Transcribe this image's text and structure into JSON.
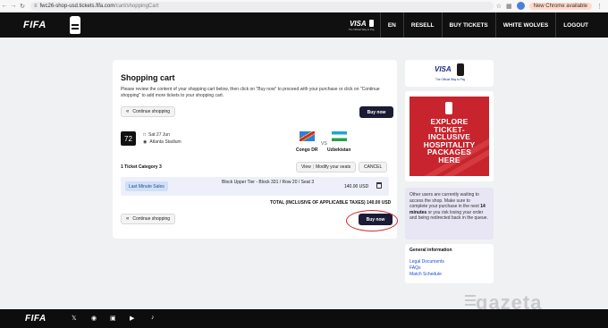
{
  "browser": {
    "url_host": "fwc26-shop-usd.tickets.fifa.com",
    "url_path": "/cart/shoppingCart",
    "update_label": "New Chrome available"
  },
  "header": {
    "logo": "FIFA",
    "visa_logo": "VISA",
    "visa_tagline": "The Official Way to Pay",
    "nav": [
      "EN",
      "RESELL",
      "BUY TICKETS",
      "WHITE WOLVES",
      "LOGOUT"
    ]
  },
  "cart": {
    "title": "Shopping cart",
    "description": "Please review the content of your shopping cart below, then click on \"Buy now\" to proceed with your purchase or click on \"Continue shopping\" to add more tickets to your shopping cart.",
    "continue_label": "Continue shopping",
    "buy_label": "Buy now",
    "match": {
      "number": "72",
      "date": "Sat 27 Jun",
      "venue": "Atlanta Stadium",
      "home_team": "Congo DR",
      "away_team": "Uzbekistan",
      "vs": "VS"
    },
    "ticket_count": "1 Ticket Category 3",
    "view_label": "View",
    "modify_label": "Modify your seats",
    "cancel_label": "CANCEL",
    "ticket": {
      "sale_type": "Last Minute Sales",
      "description": "Block Upper Tier - Block 331 / Row 20 / Seat 3",
      "price": "140.00 USD"
    },
    "total": "TOTAL (INCLUSIVE OF APPLICABLE TAXES) 140.00 USD"
  },
  "sidebar": {
    "visa_logo": "VISA",
    "visa_tagline": "The Official Way to Pay",
    "promo_lines": [
      "EXPLORE",
      "TICKET-",
      "INCLUSIVE",
      "HOSPITALITY",
      "PACKAGES",
      "HERE"
    ],
    "wait_text_1": "Other users are currently waiting to access the shop. Make sure to complete your purchase in the next",
    "wait_minutes": "14 minutes",
    "wait_text_2": "or you risk losing your order and being redirected back in the queue.",
    "general_info_title": "General information",
    "links": [
      "Legal Documents",
      "FAQs",
      "Match Schedule"
    ]
  },
  "watermark": "gazeta",
  "footer": {
    "logo": "FIFA"
  }
}
